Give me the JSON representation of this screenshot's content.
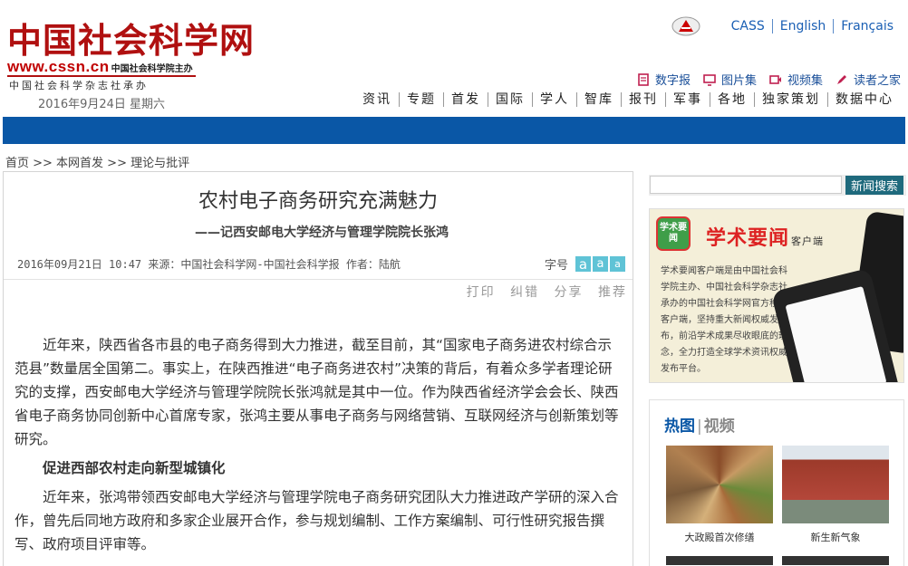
{
  "header": {
    "logo_text": "中国社会科学网",
    "logo_url": "www.cssn.cn",
    "logo_url_sub": "中国社会科学院主办",
    "logo_tagline": "中国社会科学杂志社承办",
    "date": "2016年9月24日  星期六",
    "top_links": {
      "cass_cn": "中国社会科学院",
      "items": [
        "CASS",
        "English",
        "Français"
      ]
    },
    "media_links": [
      {
        "label": "数字报",
        "icon": "newspaper-icon"
      },
      {
        "label": "图片集",
        "icon": "monitor-icon"
      },
      {
        "label": "视频集",
        "icon": "video-icon"
      },
      {
        "label": "读者之家",
        "icon": "pen-icon"
      }
    ],
    "nav": [
      "资讯",
      "专题",
      "首发",
      "国际",
      "学人",
      "智库",
      "报刊",
      "军事",
      "各地",
      "独家策划",
      "数据中心"
    ]
  },
  "colors": {
    "brand_red": "#b01010",
    "nav_blue": "#0a57a6",
    "accent_cyan": "#5fc3d6"
  },
  "breadcrumb": "首页 >> 本网首发 >> 理论与批评",
  "article": {
    "title": "农村电子商务研究充满魅力",
    "subtitle": "——记西安邮电大学经济与管理学院院长张鸿",
    "meta": "2016年09月21日 10:47 来源：中国社会科学网-中国社会科学报 作者：陆航",
    "font_size_label": "字号",
    "font_size_options": [
      "a",
      "a",
      "a"
    ],
    "tools": [
      "打印",
      "纠错",
      "分享",
      "推荐"
    ],
    "paragraphs": [
      "近年来，陕西省各市县的电子商务得到大力推进，截至目前，其“国家电子商务进农村综合示范县”数量居全国第二。事实上，在陕西推进“电子商务进农村”决策的背后，有着众多学者理论研究的支撑，西安邮电大学经济与管理学院院长张鸿就是其中一位。作为陕西省经济学会会长、陕西省电子商务协同创新中心首席专家，张鸿主要从事电子商务与网络营销、互联网经济与创新策划等研究。"
    ],
    "section_heading": "促进西部农村走向新型城镇化",
    "paragraphs2": [
      "近年来，张鸿带领西安邮电大学经济与管理学院电子商务研究团队大力推进政产学研的深入合作，曾先后同地方政府和多家企业展开合作，参与规划编制、工作方案编制、可行性研究报告撰写、政府项目评审等。"
    ]
  },
  "sidebar": {
    "search_button": "新闻搜索",
    "search_placeholder": "",
    "ad": {
      "badge": "学术要闻",
      "title": "学术要闻",
      "title_suffix": "客户端",
      "text": "学术要闻客户端是由中国社会科学院主办、中国社会科学杂志社承办的中国社会科学网官方移动客户端，坚持重大新闻权威发布，前沿学术成果尽收眼底的理念，全力打造全球学术资讯权威发布平台。"
    },
    "hot": {
      "tab_hot": "热图",
      "tab_video": "视频",
      "items": [
        {
          "caption": "大政殿首次修缮"
        },
        {
          "caption": "新生新气象"
        }
      ]
    }
  }
}
